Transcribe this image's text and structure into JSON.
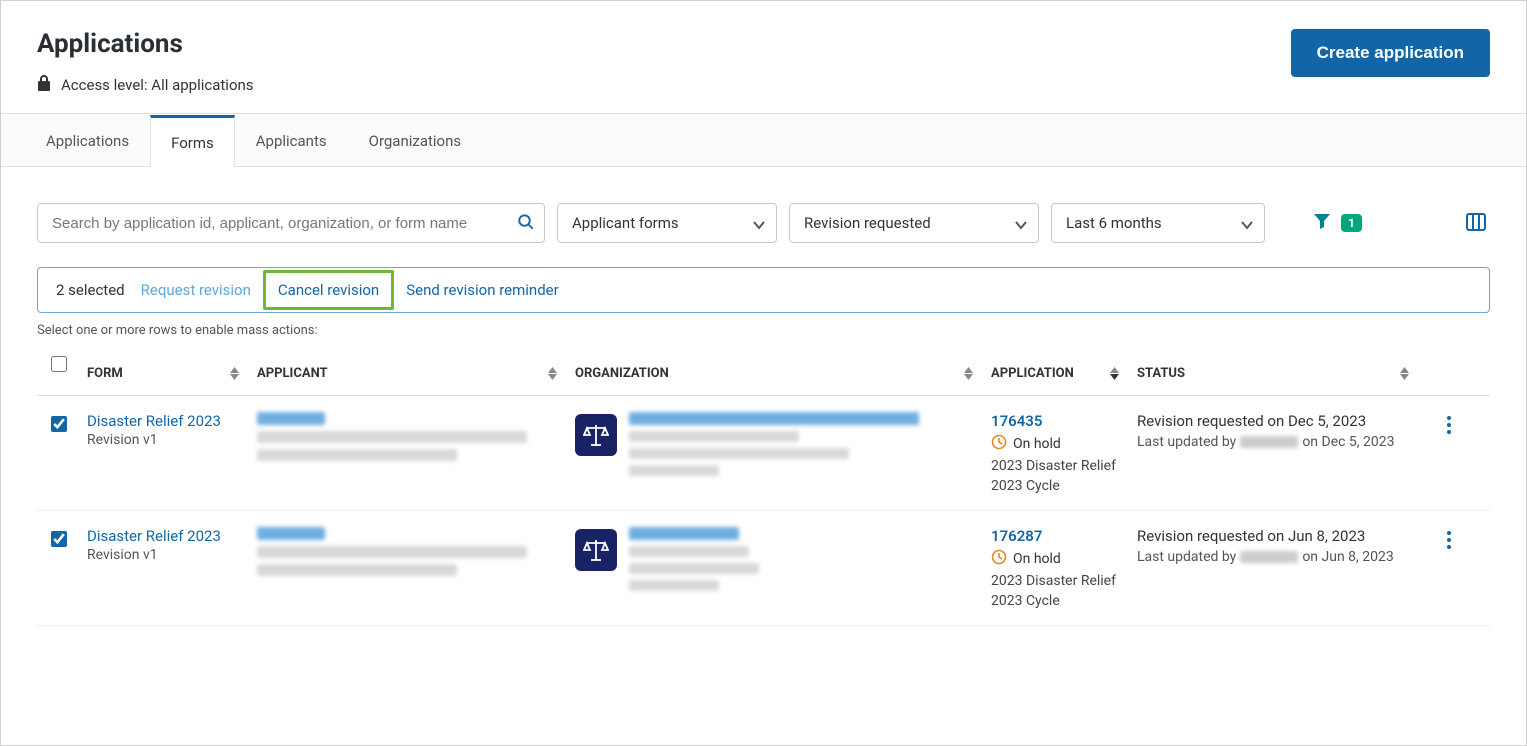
{
  "header": {
    "title": "Applications",
    "access_level_label": "Access level: All applications",
    "create_button": "Create application"
  },
  "tabs": {
    "applications": "Applications",
    "forms": "Forms",
    "applicants": "Applicants",
    "organizations": "Organizations",
    "active": "forms"
  },
  "toolbar": {
    "search_placeholder": "Search by application id, applicant, organization, or form name",
    "select_form_type": "Applicant forms",
    "select_status": "Revision requested",
    "select_date": "Last 6 months",
    "filter_badge": "1"
  },
  "action_bar": {
    "selected_text": "2 selected",
    "request_revision": "Request revision",
    "cancel_revision": "Cancel revision",
    "send_reminder": "Send revision reminder",
    "helper": "Select one or more rows to enable mass actions:"
  },
  "table": {
    "headers": {
      "form": "FORM",
      "applicant": "APPLICANT",
      "organization": "ORGANIZATION",
      "application": "APPLICATION",
      "status": "STATUS"
    },
    "rows": [
      {
        "checked": true,
        "form_name": "Disaster Relief 2023",
        "revision": "Revision v1",
        "app_id": "176435",
        "hold_label": "On hold",
        "program": "2023 Disaster Relief",
        "cycle": "2023 Cycle",
        "status_line": "Revision requested on Dec 5, 2023",
        "updated_prefix": "Last updated by",
        "updated_suffix": "on Dec 5, 2023"
      },
      {
        "checked": true,
        "form_name": "Disaster Relief 2023",
        "revision": "Revision v1",
        "app_id": "176287",
        "hold_label": "On hold",
        "program": "2023 Disaster Relief",
        "cycle": "2023 Cycle",
        "status_line": "Revision requested on Jun 8, 2023",
        "updated_prefix": "Last updated by",
        "updated_suffix": "on Jun 8, 2023"
      }
    ]
  }
}
